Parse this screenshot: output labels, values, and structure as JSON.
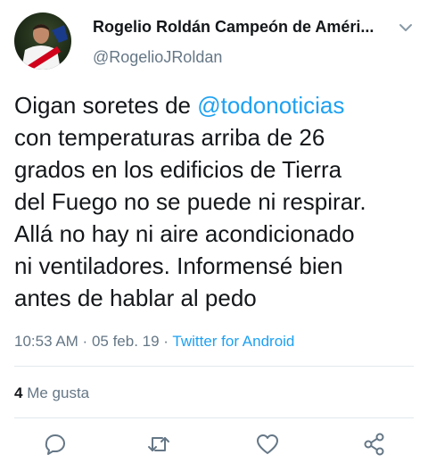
{
  "user": {
    "display_name": "Rogelio Roldán Campeón de Améri...",
    "handle": "@RogelioJRoldan"
  },
  "tweet": {
    "text_before": "Oigan soretes de ",
    "mention": "@todonoticias",
    "text_after": "\ncon temperaturas arriba de 26\ngrados en los edificios de Tierra\ndel Fuego no se puede ni respirar.\nAllá no hay ni aire acondicionado\nni ventiladores. Informensé bien\nantes de hablar al pedo"
  },
  "meta": {
    "time": "10:53 AM",
    "date": "05 feb. 19",
    "separator": " · ",
    "source": "Twitter for Android"
  },
  "stats": {
    "likes_count": "4",
    "likes_label": " Me gusta"
  },
  "actions": [
    "reply-icon",
    "retweet-icon",
    "like-icon",
    "share-icon"
  ],
  "colors": {
    "accent": "#1da1f2",
    "secondary_text": "#657786",
    "primary_text": "#14171a",
    "divider": "#e1e8ed"
  }
}
